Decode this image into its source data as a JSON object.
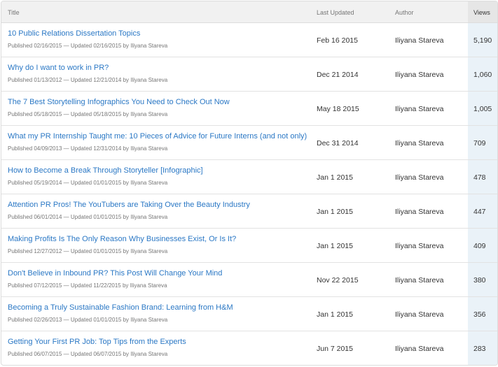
{
  "columns": {
    "title": "Title",
    "last_updated": "Last Updated",
    "author": "Author",
    "views": "Views"
  },
  "rows": [
    {
      "title": "10 Public Relations Dissertation Topics",
      "meta": "Published 02/16/2015 — Updated 02/16/2015 by Iliyana Stareva",
      "last_updated": "Feb 16 2015",
      "author": "Iliyana Stareva",
      "views": "5,190"
    },
    {
      "title": "Why do I want to work in PR?",
      "meta": "Published 01/13/2012 — Updated 12/21/2014 by Iliyana Stareva",
      "last_updated": "Dec 21 2014",
      "author": "Iliyana Stareva",
      "views": "1,060"
    },
    {
      "title": "The 7 Best Storytelling Infographics You Need to Check Out Now",
      "meta": "Published 05/18/2015 — Updated 05/18/2015 by Iliyana Stareva",
      "last_updated": "May 18 2015",
      "author": "Iliyana Stareva",
      "views": "1,005"
    },
    {
      "title": "What my PR Internship Taught me: 10 Pieces of Advice for Future Interns (and not only)",
      "meta": "Published 04/09/2013 — Updated 12/31/2014 by Iliyana Stareva",
      "last_updated": "Dec 31 2014",
      "author": "Iliyana Stareva",
      "views": "709"
    },
    {
      "title": "How to Become a Break Through Storyteller [Infographic]",
      "meta": "Published 05/19/2014 — Updated 01/01/2015 by Iliyana Stareva",
      "last_updated": "Jan 1 2015",
      "author": "Iliyana Stareva",
      "views": "478"
    },
    {
      "title": "Attention PR Pros! The YouTubers are Taking Over the Beauty Industry",
      "meta": "Published 06/01/2014 — Updated 01/01/2015 by Iliyana Stareva",
      "last_updated": "Jan 1 2015",
      "author": "Iliyana Stareva",
      "views": "447"
    },
    {
      "title": "Making Profits Is The Only Reason Why Businesses Exist, Or Is It?",
      "meta": "Published 12/27/2012 — Updated 01/01/2015 by Iliyana Stareva",
      "last_updated": "Jan 1 2015",
      "author": "Iliyana Stareva",
      "views": "409"
    },
    {
      "title": "Don't Believe in Inbound PR? This Post Will Change Your Mind",
      "meta": "Published 07/12/2015 — Updated 11/22/2015 by Iliyana Stareva",
      "last_updated": "Nov 22 2015",
      "author": "Iliyana Stareva",
      "views": "380"
    },
    {
      "title": "Becoming a Truly Sustainable Fashion Brand: Learning from H&M",
      "meta": "Published 02/26/2013 — Updated 01/01/2015 by Iliyana Stareva",
      "last_updated": "Jan 1 2015",
      "author": "Iliyana Stareva",
      "views": "356"
    },
    {
      "title": "Getting Your First PR Job: Top Tips from the Experts",
      "meta": "Published 06/07/2015 — Updated 06/07/2015 by Iliyana Stareva",
      "last_updated": "Jun 7 2015",
      "author": "Iliyana Stareva",
      "views": "283"
    }
  ],
  "colors": {
    "link": "#2b78c5",
    "header_bg": "#f1f1f1",
    "views_column_bg": "#eaf2f8"
  }
}
